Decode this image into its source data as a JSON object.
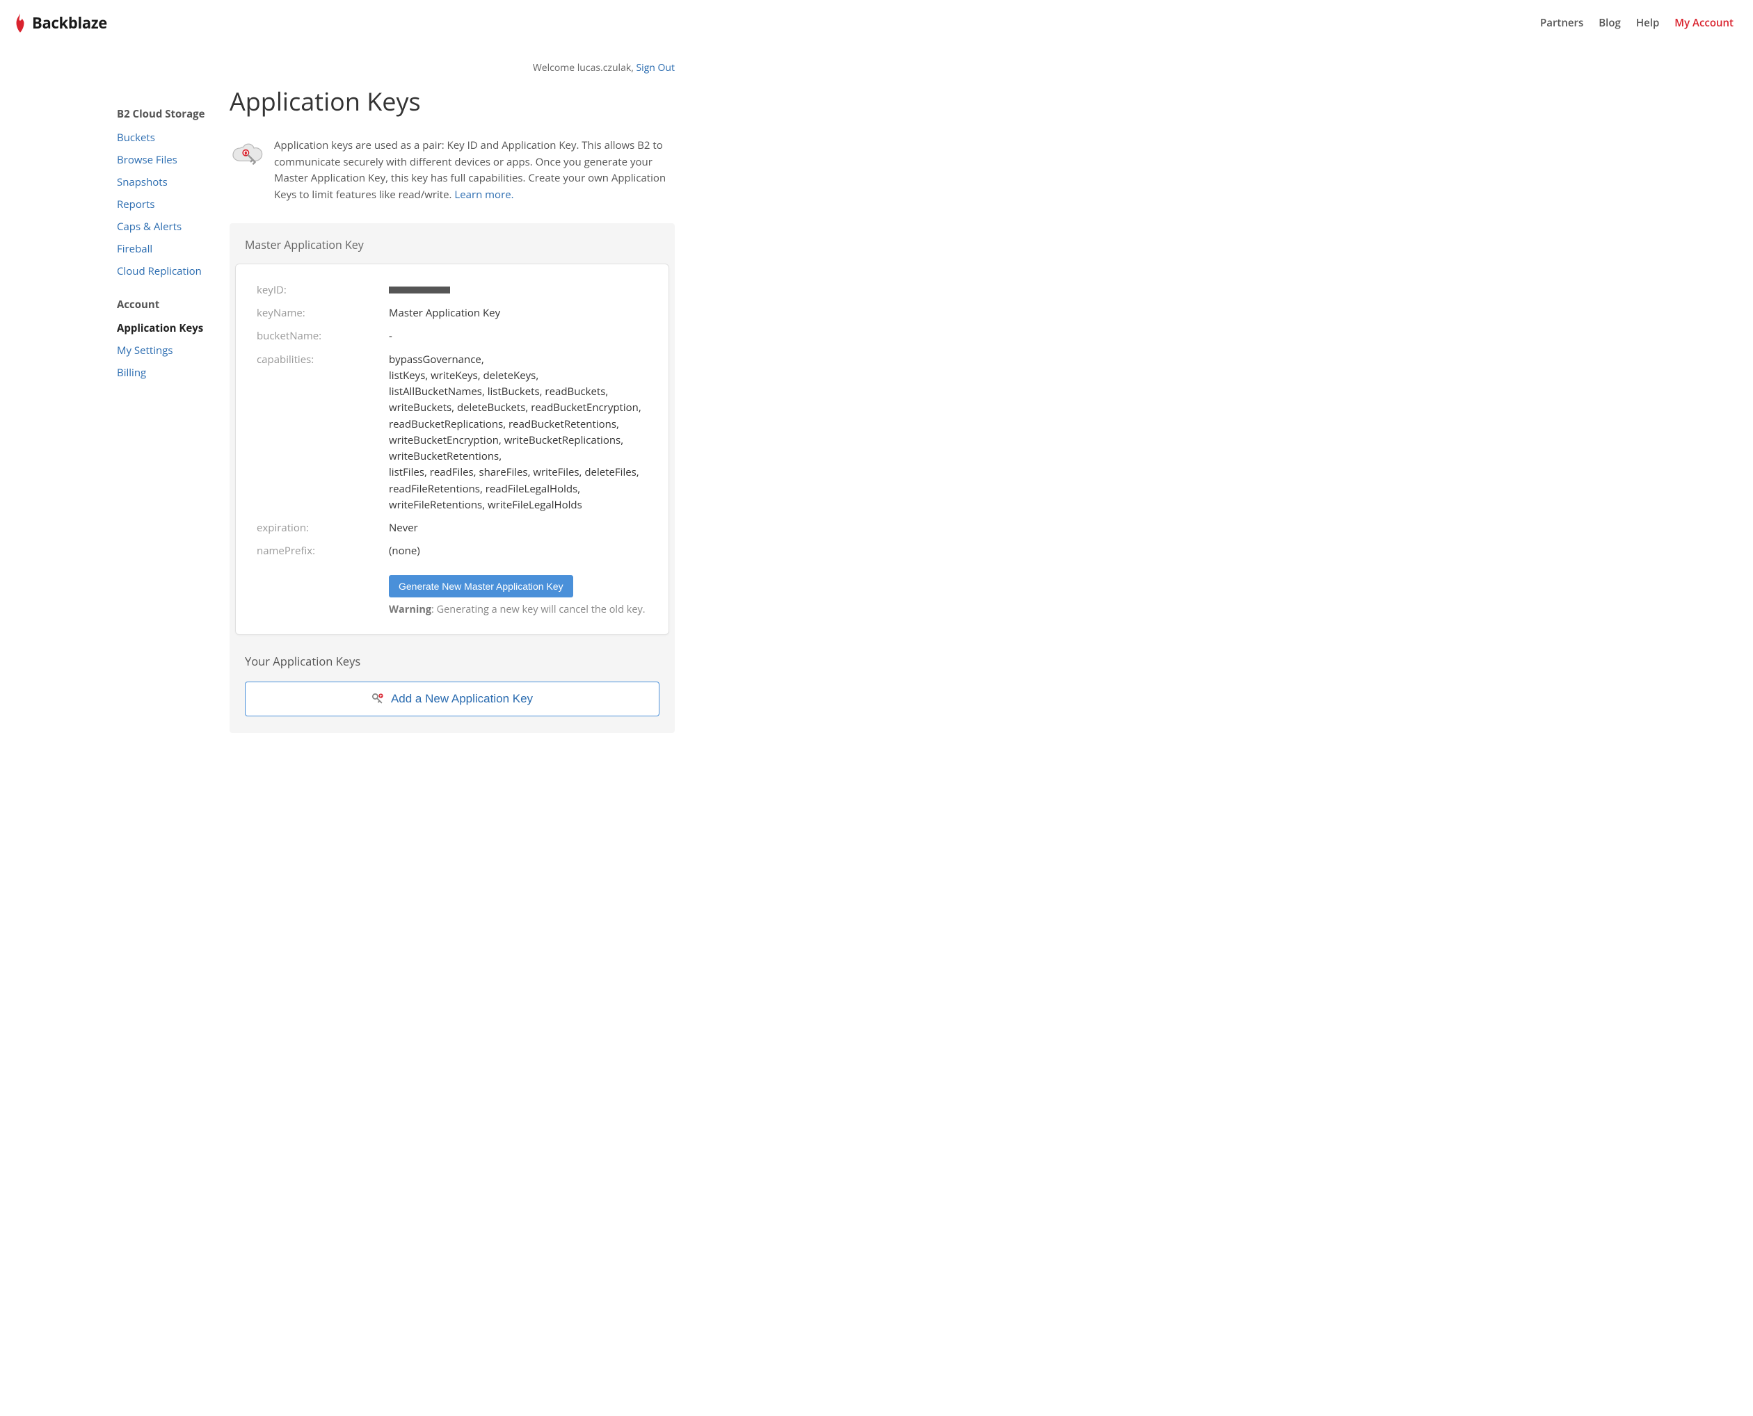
{
  "brand": "Backblaze",
  "topNav": {
    "partners": "Partners",
    "blog": "Blog",
    "help": "Help",
    "myAccount": "My Account"
  },
  "welcome": {
    "prefix": "Welcome lucas.czulak, ",
    "signOut": "Sign Out"
  },
  "sidebar": {
    "storageTitle": "B2 Cloud Storage",
    "storageItems": [
      {
        "label": "Buckets"
      },
      {
        "label": "Browse Files"
      },
      {
        "label": "Snapshots"
      },
      {
        "label": "Reports"
      },
      {
        "label": "Caps & Alerts"
      },
      {
        "label": "Fireball"
      },
      {
        "label": "Cloud Replication"
      }
    ],
    "accountTitle": "Account",
    "accountItems": [
      {
        "label": "Application Keys",
        "active": true
      },
      {
        "label": "My Settings"
      },
      {
        "label": "Billing"
      }
    ]
  },
  "page": {
    "title": "Application Keys",
    "intro": "Application keys are used as a pair: Key ID and Application Key. This allows B2 to communicate securely with different devices or apps. Once you generate your Master Application Key, this key has full capabilities. Create your own Application Keys to limit features like read/write. ",
    "learnMore": "Learn more."
  },
  "master": {
    "panelTitle": "Master Application Key",
    "labels": {
      "keyID": "keyID:",
      "keyName": "keyName:",
      "bucketName": "bucketName:",
      "capabilities": "capabilities:",
      "expiration": "expiration:",
      "namePrefix": "namePrefix:"
    },
    "values": {
      "keyName": "Master Application Key",
      "bucketName": "-",
      "capabilities": "bypassGovernance,\nlistKeys, writeKeys, deleteKeys,\nlistAllBucketNames, listBuckets, readBuckets, writeBuckets, deleteBuckets, readBucketEncryption, readBucketReplications, readBucketRetentions, writeBucketEncryption, writeBucketReplications, writeBucketRetentions,\nlistFiles, readFiles, shareFiles, writeFiles, deleteFiles, readFileRetentions, readFileLegalHolds, writeFileRetentions, writeFileLegalHolds",
      "expiration": "Never",
      "namePrefix": "(none)"
    },
    "generateBtn": "Generate New Master Application Key",
    "warningLabel": "Warning",
    "warningText": ": Generating a new key will cancel the old key."
  },
  "yourKeys": {
    "title": "Your Application Keys",
    "addBtn": "Add a New Application Key"
  }
}
